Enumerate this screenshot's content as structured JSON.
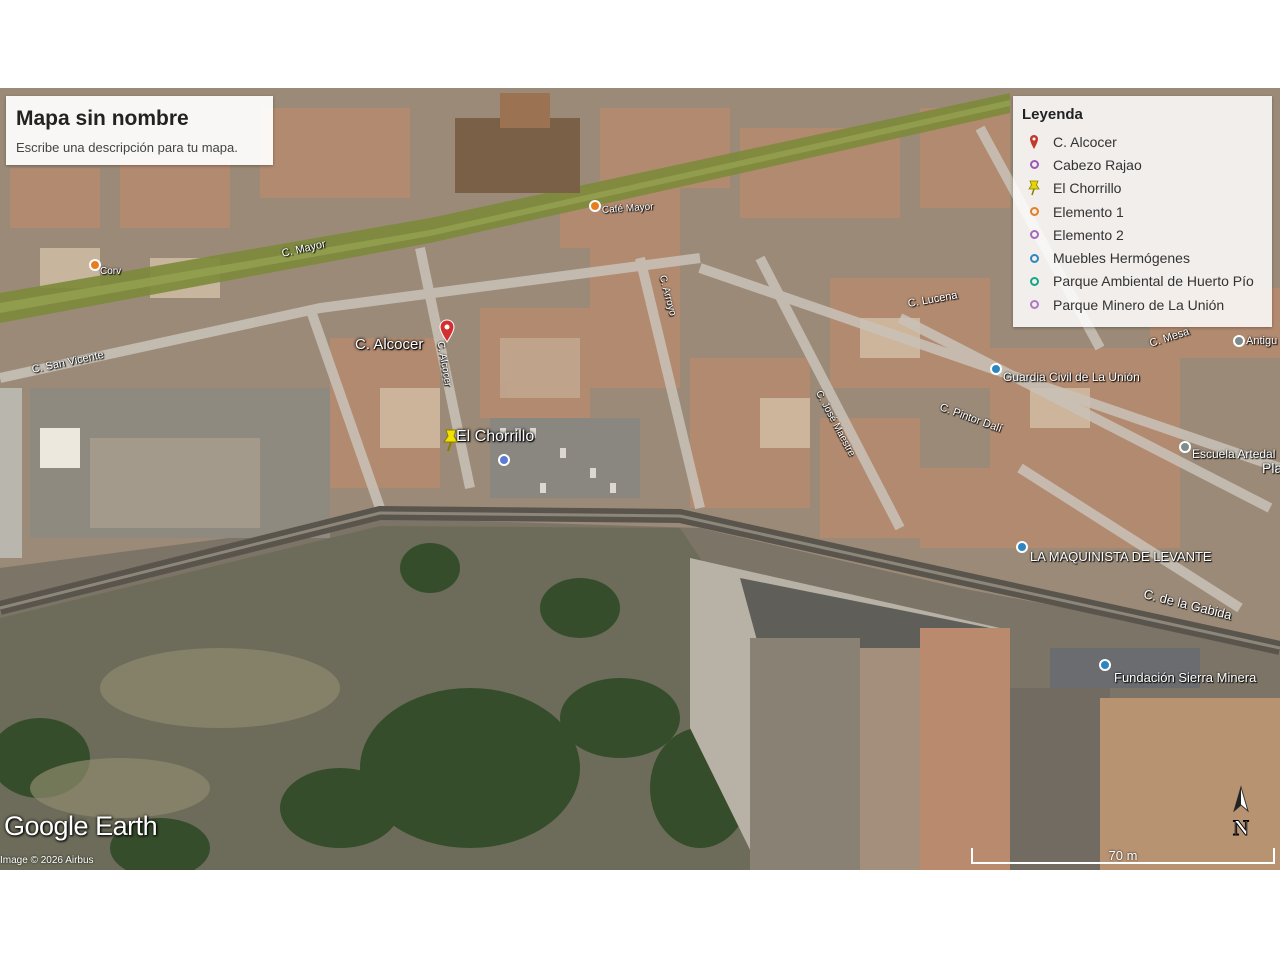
{
  "map": {
    "title": "Mapa sin nombre",
    "description": "Escribe una descripción para tu mapa."
  },
  "legend": {
    "title": "Leyenda",
    "items": [
      {
        "label": "C. Alcocer",
        "icon": "red-pin-icon",
        "color": "#c0392b"
      },
      {
        "label": "Cabezo Rajao",
        "icon": "purple-circle-icon",
        "color": "#9b59b6"
      },
      {
        "label": "El Chorrillo",
        "icon": "yellow-pushpin-icon",
        "color": "#e5d400"
      },
      {
        "label": "Elemento 1",
        "icon": "orange-circle-icon",
        "color": "#e67e22"
      },
      {
        "label": "Elemento 2",
        "icon": "violet-circle-icon",
        "color": "#a569bd"
      },
      {
        "label": "Muebles Hermógenes",
        "icon": "blue-circle-icon",
        "color": "#2e86c1"
      },
      {
        "label": "Parque Ambiental de Huerto Pío",
        "icon": "teal-circle-icon",
        "color": "#17a589"
      },
      {
        "label": "Parque Minero de La Unión",
        "icon": "lavender-circle-icon",
        "color": "#af7ac5"
      }
    ]
  },
  "placemarks": {
    "alcocer": "C. Alcocer",
    "chorrillo": "El Chorrillo"
  },
  "pois": {
    "cafe": "Café Mayor",
    "corv": "Corv",
    "guardia": "Guardia Civil de La Unión",
    "escuela": "Escuela Artedal",
    "maquinista": "LA MAQUINISTA DE LEVANTE",
    "fundacion": "Fundación Sierra Minera",
    "antigu": "Antigu",
    "pla": "Pla"
  },
  "streets": {
    "mayor": "C. Mayor",
    "san_vicente": "C. San Vicente",
    "alcocer_st": "C. Alcocer",
    "gabida": "C. de la Gabida",
    "pintor": "C. Pintor Dalí",
    "maestro": "C. José Maestre",
    "vertical": "C. Arroyo",
    "lucena": "C. Lucena",
    "mesa": "C. Mesa"
  },
  "attribution": {
    "logo": "Google Earth",
    "credit": "Image © 2026 Airbus",
    "scale": "70 m",
    "compass": "N"
  }
}
